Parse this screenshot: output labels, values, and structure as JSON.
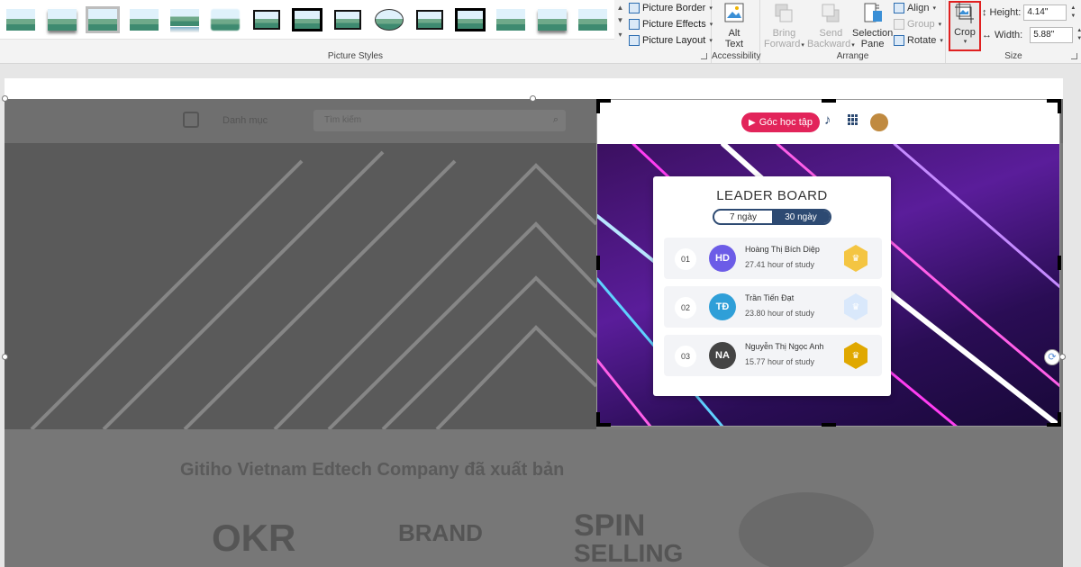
{
  "ribbon": {
    "picture_styles_label": "Picture Styles",
    "menu": {
      "border": "Picture Border",
      "effects": "Picture Effects",
      "layout": "Picture Layout"
    },
    "accessibility": {
      "label": "Accessibility",
      "alt_text_line1": "Alt",
      "alt_text_line2": "Text"
    },
    "arrange": {
      "label": "Arrange",
      "bring_line1": "Bring",
      "bring_line2": "Forward",
      "send_line1": "Send",
      "send_line2": "Backward",
      "selection_line1": "Selection",
      "selection_line2": "Pane",
      "align": "Align",
      "group": "Group",
      "rotate": "Rotate"
    },
    "size": {
      "label": "Size",
      "crop": "Crop",
      "height_label": "Height:",
      "height_value": "4.14\"",
      "width_label": "Width:",
      "width_value": "5.88\""
    }
  },
  "page": {
    "bg_menu": "Danh mục",
    "bg_search": "Tìm kiếm",
    "bg_heading": "Gitiho Vietnam Edtech Company đã xuất bản",
    "book1": "OKR",
    "book2": "BRAND",
    "book3": "SPIN",
    "book3b": "SELLING"
  },
  "leaderboard_page": {
    "goc_hoc_tap": "Góc học tập",
    "title": "LEADER BOARD",
    "tab_7": "7 ngày",
    "tab_30": "30 ngày",
    "rows": [
      {
        "rank": "01",
        "initials": "HD",
        "name": "Hoàng Thị Bích Diệp",
        "hours": "27.41 hour of study",
        "color": "#6c5ce7",
        "badge": "#f4c542"
      },
      {
        "rank": "02",
        "initials": "TĐ",
        "name": "Trần Tiến Đạt",
        "hours": "23.80 hour of study",
        "color": "#2f9fd8",
        "badge": "#d9e8fb"
      },
      {
        "rank": "03",
        "initials": "NA",
        "name": "Nguyễn Thị Ngọc Anh",
        "hours": "15.77 hour of study",
        "color": "#444444",
        "badge": "#e0a800"
      }
    ]
  },
  "colors": {
    "accent": "#e02020",
    "brand_pink": "#e2245a",
    "navy": "#2d4a72"
  }
}
